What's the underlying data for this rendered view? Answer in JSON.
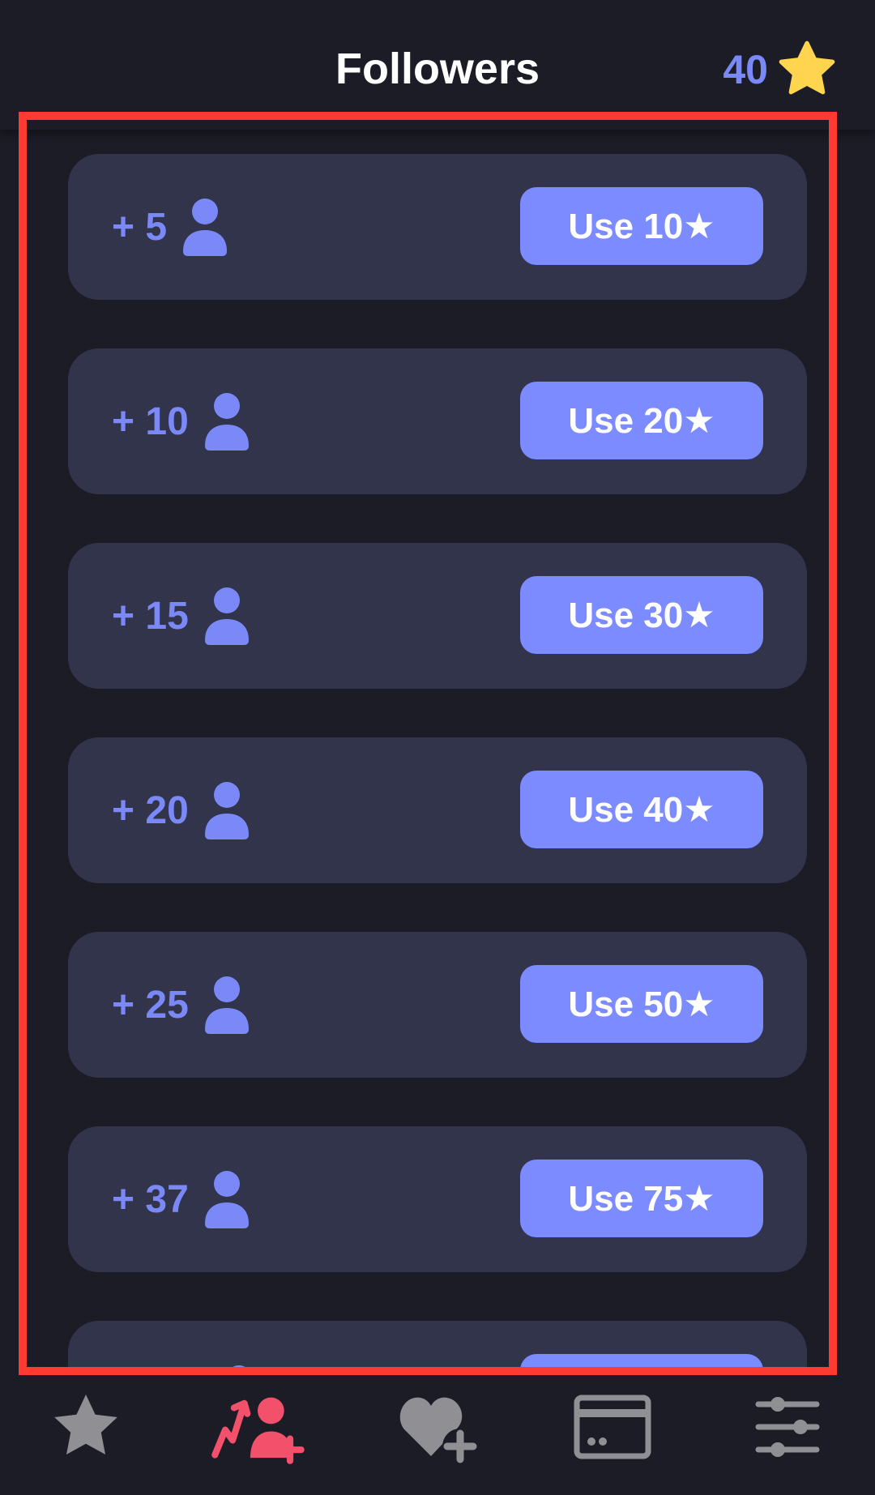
{
  "header": {
    "title": "Followers",
    "star_balance": "40"
  },
  "offers": [
    {
      "amount": "+ 5",
      "button_label": "Use 10★"
    },
    {
      "amount": "+ 10",
      "button_label": "Use 20★"
    },
    {
      "amount": "+ 15",
      "button_label": "Use 30★"
    },
    {
      "amount": "+ 20",
      "button_label": "Use 40★"
    },
    {
      "amount": "+ 25",
      "button_label": "Use 50★"
    },
    {
      "amount": "+ 37",
      "button_label": "Use 75★"
    },
    {
      "amount": "",
      "button_label": ""
    }
  ],
  "bottom_nav": {
    "items": [
      {
        "icon": "star-icon",
        "active": false
      },
      {
        "icon": "followers-growth-icon",
        "active": true
      },
      {
        "icon": "heart-plus-icon",
        "active": false
      },
      {
        "icon": "card-icon",
        "active": false
      },
      {
        "icon": "sliders-icon",
        "active": false
      }
    ]
  },
  "colors": {
    "background": "#1c1c27",
    "card": "#31344a",
    "accent": "#7c8bff",
    "highlight": "#ff3a30",
    "active_nav": "#f2506b",
    "inactive_nav": "#8f8f94",
    "star": "#ffd54f"
  }
}
